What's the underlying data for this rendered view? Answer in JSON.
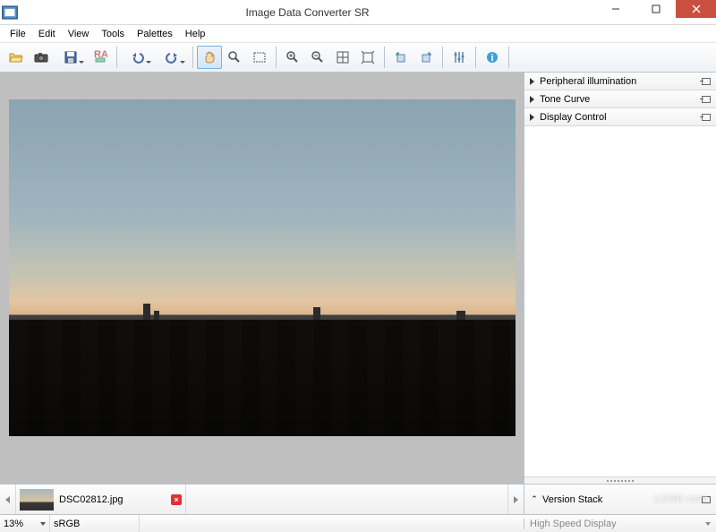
{
  "title": "Image Data Converter SR",
  "menu": {
    "file": "File",
    "edit": "Edit",
    "view": "View",
    "tools": "Tools",
    "palettes": "Palettes",
    "help": "Help"
  },
  "panels": {
    "peripheral": "Peripheral illumination",
    "tone": "Tone Curve",
    "display": "Display Control",
    "version_stack": "Version Stack"
  },
  "thumb": {
    "filename": "DSC02812.jpg"
  },
  "status": {
    "zoom": "13%",
    "colorspace": "sRGB",
    "display_mode": "High Speed Display"
  },
  "watermark": "LO4D.com"
}
